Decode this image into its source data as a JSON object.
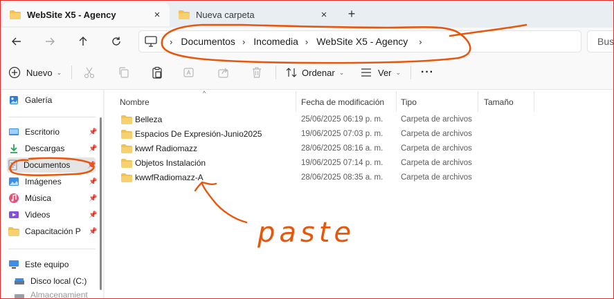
{
  "tabs": [
    {
      "title": "WebSite X5 - Agency",
      "close": "×"
    },
    {
      "title": "Nueva carpeta",
      "close": "×"
    }
  ],
  "new_tab": "+",
  "breadcrumb": [
    "Documentos",
    "Incomedia",
    "WebSite X5 - Agency"
  ],
  "breadcrumb_sep": "›",
  "search_placeholder": "Bus",
  "toolbar": {
    "new_label": "Nuevo",
    "sort_label": "Ordenar",
    "view_label": "Ver",
    "more_label": "···"
  },
  "sidebar": {
    "top": {
      "label": "Galería"
    },
    "pinned": [
      {
        "label": "Escritorio",
        "icon": "desktop-icon"
      },
      {
        "label": "Descargas",
        "icon": "download-icon"
      },
      {
        "label": "Documentos",
        "icon": "documents-icon"
      },
      {
        "label": "Imágenes",
        "icon": "pictures-icon"
      },
      {
        "label": "Música",
        "icon": "music-icon"
      },
      {
        "label": "Videos",
        "icon": "videos-icon"
      },
      {
        "label": "Capacitación P",
        "icon": "folder-icon"
      }
    ],
    "this_pc": {
      "label": "Este equipo"
    },
    "drives": [
      {
        "label": "Disco local (C:)"
      },
      {
        "label": "Almacenamient"
      }
    ]
  },
  "columns": {
    "name": "Nombre",
    "date": "Fecha de modificación",
    "type": "Tipo",
    "size": "Tamaño"
  },
  "files": [
    {
      "name": "Belleza",
      "date": "25/06/2025 06:19 p. m.",
      "type": "Carpeta de archivos"
    },
    {
      "name": "Espacios De Expresión-Junio2025",
      "date": "19/06/2025 07:03 p. m.",
      "type": "Carpeta de archivos"
    },
    {
      "name": "kwwf Radiomazz",
      "date": "28/06/2025 08:16 a. m.",
      "type": "Carpeta de archivos"
    },
    {
      "name": "Objetos Instalación",
      "date": "19/06/2025 07:14 p. m.",
      "type": "Carpeta de archivos"
    },
    {
      "name": "kwwfRadiomazz-A",
      "date": "28/06/2025 08:35 a. m.",
      "type": "Carpeta de archivos"
    }
  ],
  "annotation": {
    "text": "paste",
    "color": "#e8560b"
  },
  "colors": {
    "folder": "#f2c14e",
    "annotation": "#e8560b",
    "window_border": "#e02c2c"
  }
}
